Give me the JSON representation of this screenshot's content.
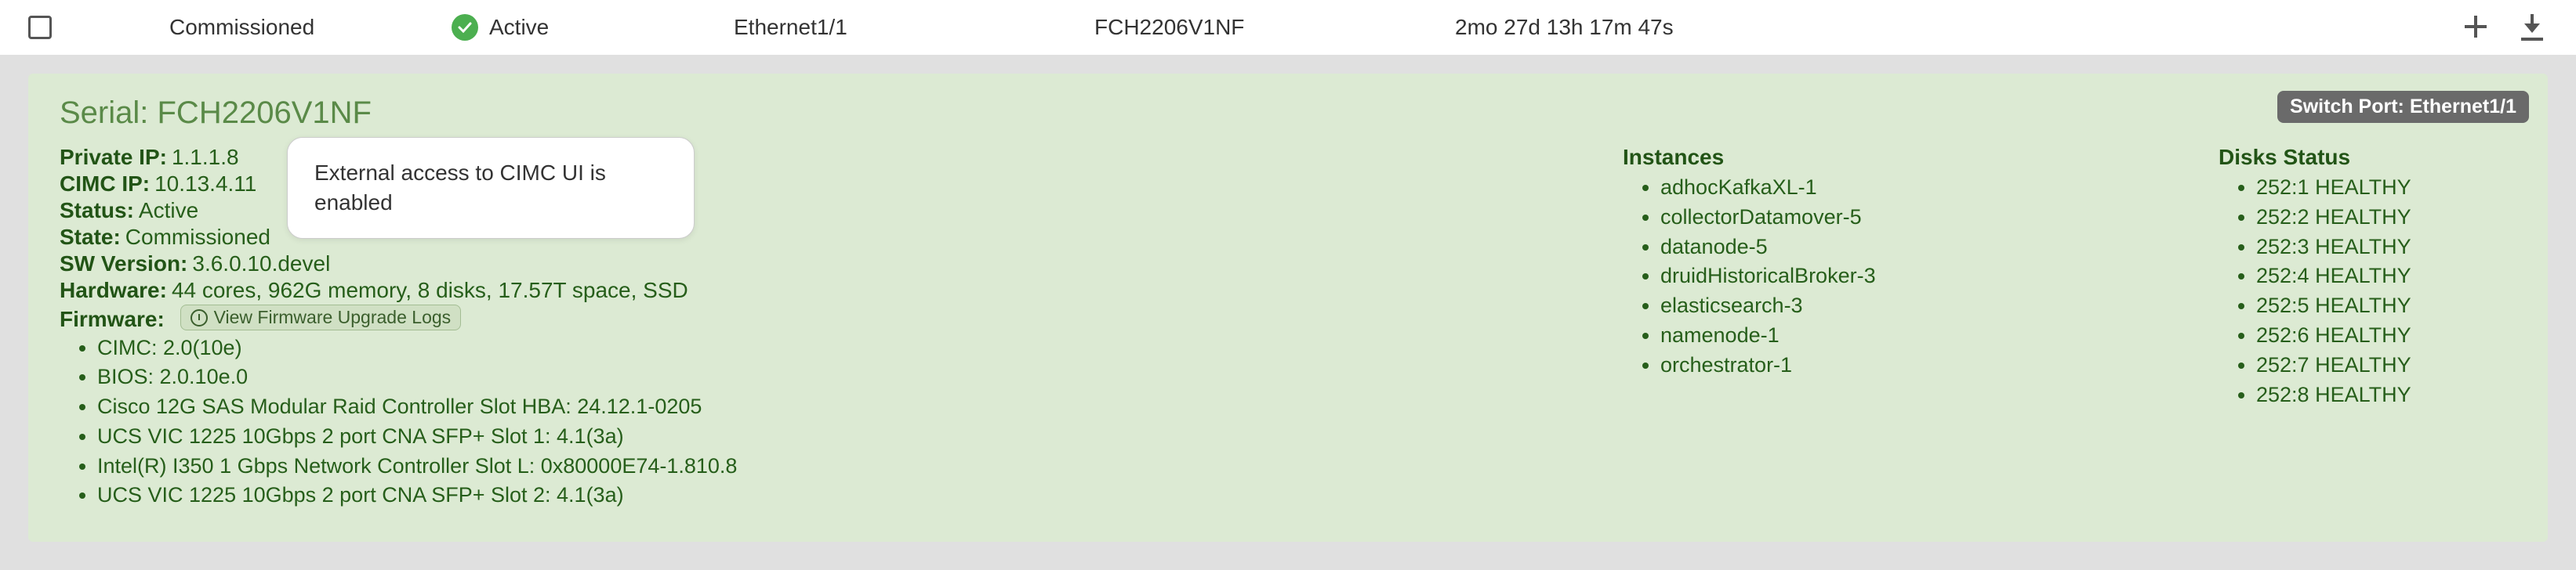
{
  "header": {
    "commission": "Commissioned",
    "active": "Active",
    "eth": "Ethernet1/1",
    "serial": "FCH2206V1NF",
    "uptime": "2mo 27d 13h 17m 47s"
  },
  "badge": "Switch Port: Ethernet1/1",
  "title_prefix": "Serial: ",
  "title_serial": "FCH2206V1NF",
  "tooltip": "External access to CIMC UI is enabled",
  "kv": {
    "private_ip_lbl": "Private IP:",
    "private_ip": "1.1.1.8",
    "cimc_ip_lbl": "CIMC IP:",
    "cimc_ip": "10.13.4.11",
    "status_lbl": "Status:",
    "status": "Active",
    "state_lbl": "State:",
    "state": "Commissioned",
    "sw_lbl": "SW Version:",
    "sw": "3.6.0.10.devel",
    "hw_lbl": "Hardware:",
    "hw": "44 cores, 962G memory, 8 disks, 17.57T space, SSD",
    "fw_lbl": "Firmware:",
    "fw_btn": "View Firmware Upgrade Logs"
  },
  "firmware": [
    "CIMC: 2.0(10e)",
    "BIOS: 2.0.10e.0",
    "Cisco 12G SAS Modular Raid Controller Slot HBA: 24.12.1-0205",
    "UCS VIC 1225 10Gbps 2 port CNA SFP+ Slot 1: 4.1(3a)",
    "Intel(R) I350 1 Gbps Network Controller Slot L: 0x80000E74-1.810.8",
    "UCS VIC 1225 10Gbps 2 port CNA SFP+ Slot 2: 4.1(3a)"
  ],
  "instances_head": "Instances",
  "instances": [
    "adhocKafkaXL-1",
    "collectorDatamover-5",
    "datanode-5",
    "druidHistoricalBroker-3",
    "elasticsearch-3",
    "namenode-1",
    "orchestrator-1"
  ],
  "disks_head": "Disks Status",
  "disks": [
    "252:1 HEALTHY",
    "252:2 HEALTHY",
    "252:3 HEALTHY",
    "252:4 HEALTHY",
    "252:5 HEALTHY",
    "252:6 HEALTHY",
    "252:7 HEALTHY",
    "252:8 HEALTHY"
  ]
}
